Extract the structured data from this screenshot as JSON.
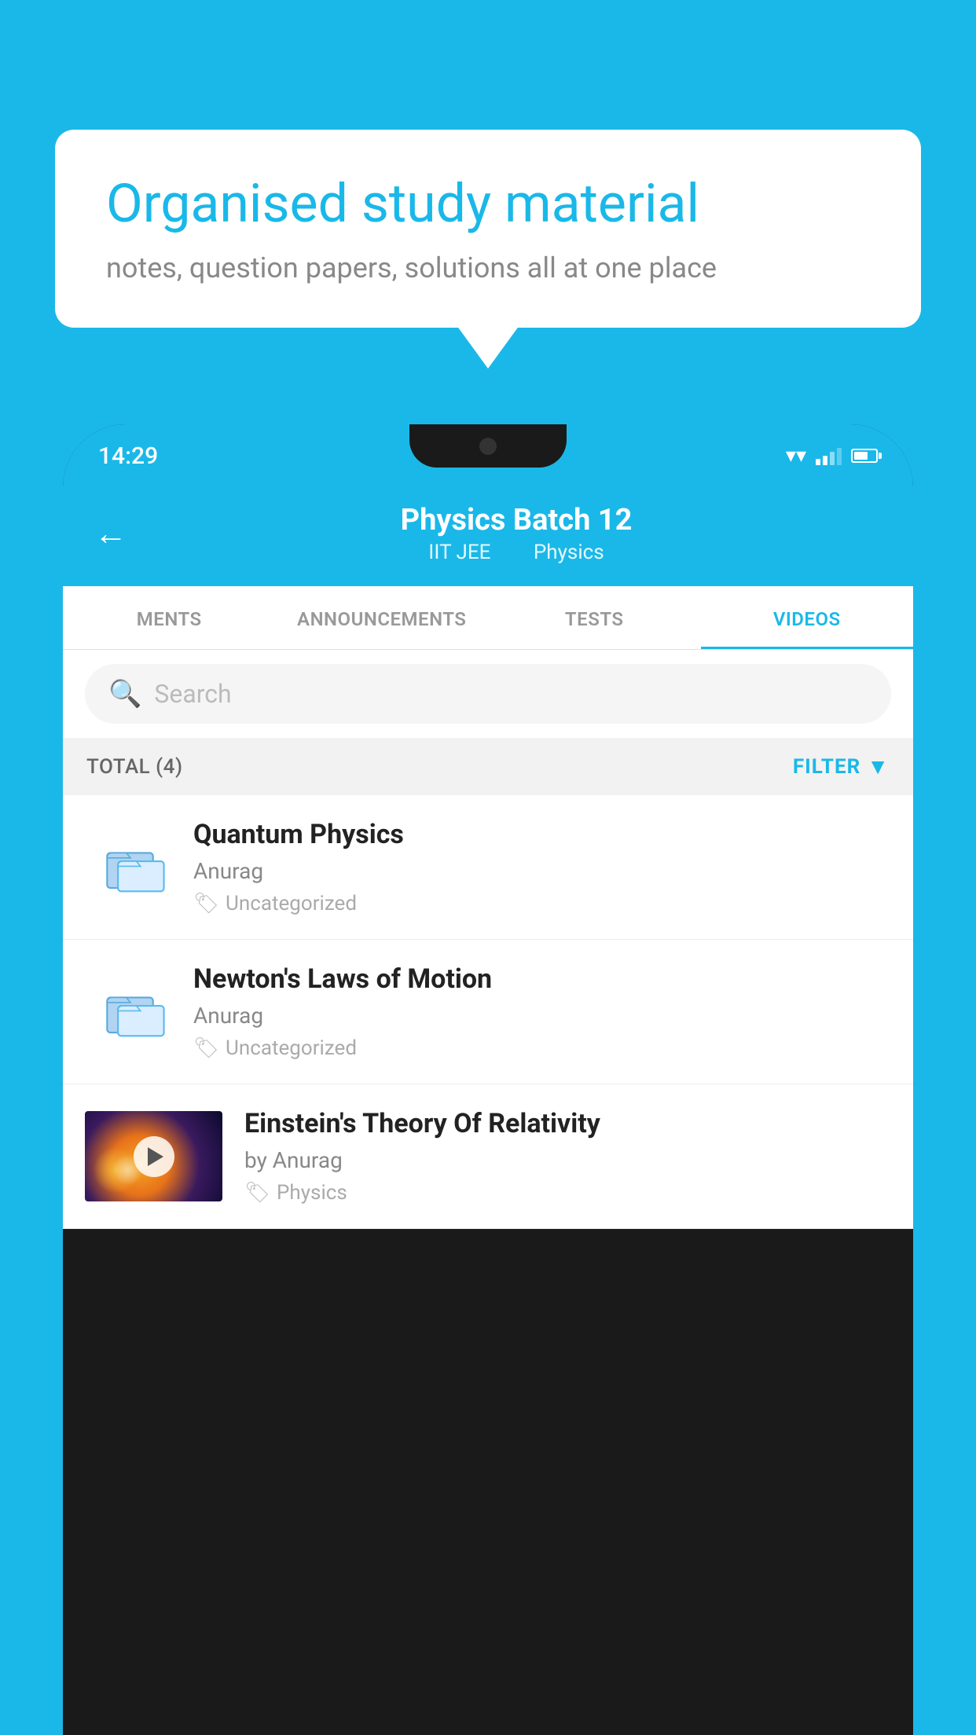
{
  "background_color": "#1ab8e8",
  "speech_bubble": {
    "title": "Organised study material",
    "subtitle": "notes, question papers, solutions all at one place"
  },
  "status_bar": {
    "time": "14:29"
  },
  "app_header": {
    "title": "Physics Batch 12",
    "subtitle_part1": "IIT JEE",
    "subtitle_part2": "Physics"
  },
  "tabs": [
    {
      "label": "MENTS",
      "active": false
    },
    {
      "label": "ANNOUNCEMENTS",
      "active": false
    },
    {
      "label": "TESTS",
      "active": false
    },
    {
      "label": "VIDEOS",
      "active": true
    }
  ],
  "search": {
    "placeholder": "Search"
  },
  "filter_row": {
    "total_label": "TOTAL (4)",
    "filter_label": "FILTER"
  },
  "videos": [
    {
      "id": 1,
      "title": "Quantum Physics",
      "author": "Anurag",
      "tag": "Uncategorized",
      "type": "folder",
      "has_thumbnail": false
    },
    {
      "id": 2,
      "title": "Newton's Laws of Motion",
      "author": "Anurag",
      "tag": "Uncategorized",
      "type": "folder",
      "has_thumbnail": false
    },
    {
      "id": 3,
      "title": "Einstein's Theory Of Relativity",
      "author": "by Anurag",
      "tag": "Physics",
      "type": "video",
      "has_thumbnail": true
    }
  ]
}
